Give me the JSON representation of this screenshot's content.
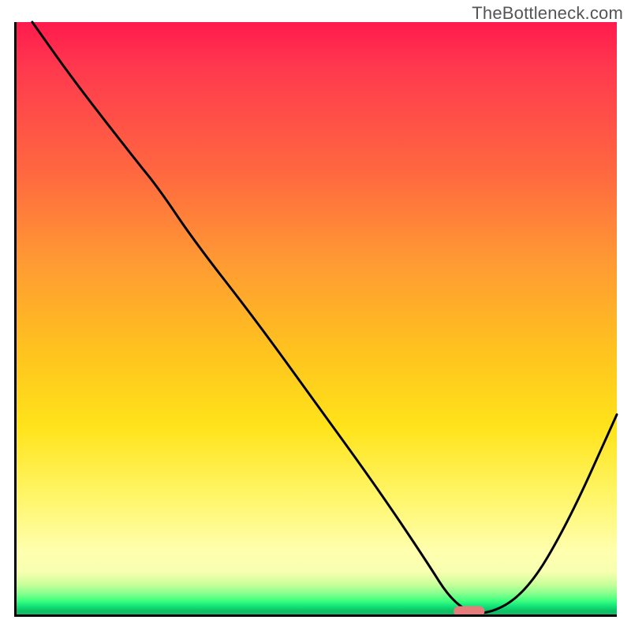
{
  "watermark": "TheBottleneck.com",
  "colors": {
    "gradient_top": "#ff1a4d",
    "gradient_mid": "#ffe31a",
    "gradient_bottom_green": "#0fbf65",
    "curve": "#000000",
    "indicator": "#e77c7c"
  },
  "chart_data": {
    "type": "line",
    "title": "",
    "xlabel": "",
    "ylabel": "",
    "xlim": [
      0,
      100
    ],
    "ylim": [
      0,
      100
    ],
    "grid": false,
    "legend": false,
    "series": [
      {
        "name": "bottleneck-curve",
        "x": [
          3,
          10,
          20,
          24,
          30,
          40,
          50,
          60,
          68,
          73,
          78,
          85,
          92,
          100
        ],
        "values": [
          100,
          90,
          77,
          72,
          63,
          50,
          36,
          22,
          10,
          2,
          0,
          4,
          16,
          34
        ]
      }
    ],
    "indicator": {
      "name": "optimal-zone",
      "x_start": 73,
      "x_end": 78,
      "y": 0
    }
  }
}
